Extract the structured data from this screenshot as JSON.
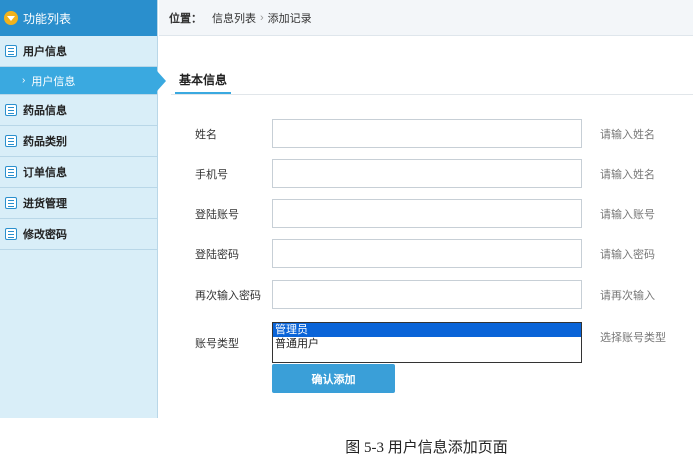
{
  "sidebar": {
    "title": "功能列表",
    "items": [
      {
        "label": "用户信息",
        "expanded": true,
        "sub": [
          {
            "label": "用户信息"
          }
        ]
      },
      {
        "label": "药品信息"
      },
      {
        "label": "药品类别"
      },
      {
        "label": "订单信息"
      },
      {
        "label": "进货管理"
      },
      {
        "label": "修改密码"
      }
    ]
  },
  "breadcrumb": {
    "label": "位置：",
    "path": [
      "信息列表",
      "添加记录"
    ]
  },
  "tab": {
    "label": "基本信息"
  },
  "form": {
    "fields": [
      {
        "label": "姓名",
        "value": "",
        "hint": "请输入姓名"
      },
      {
        "label": "手机号",
        "value": "",
        "hint": "请输入姓名"
      },
      {
        "label": "登陆账号",
        "value": "",
        "hint": "请输入账号"
      },
      {
        "label": "登陆密码",
        "value": "",
        "hint": "请输入密码"
      },
      {
        "label": "再次输入密码",
        "value": "",
        "hint": "请再次输入"
      }
    ],
    "account_type": {
      "label": "账号类型",
      "options": [
        "管理员",
        "普通用户"
      ],
      "selected": "管理员",
      "hint": "选择账号类型"
    },
    "submit_label": "确认添加"
  },
  "caption": "图 5-3 用户信息添加页面",
  "colors": {
    "accent": "#2a8fcd",
    "sidebar_bg": "#d9eef8",
    "submenu_active": "#3aa9e0",
    "button": "#3a9fd8"
  }
}
